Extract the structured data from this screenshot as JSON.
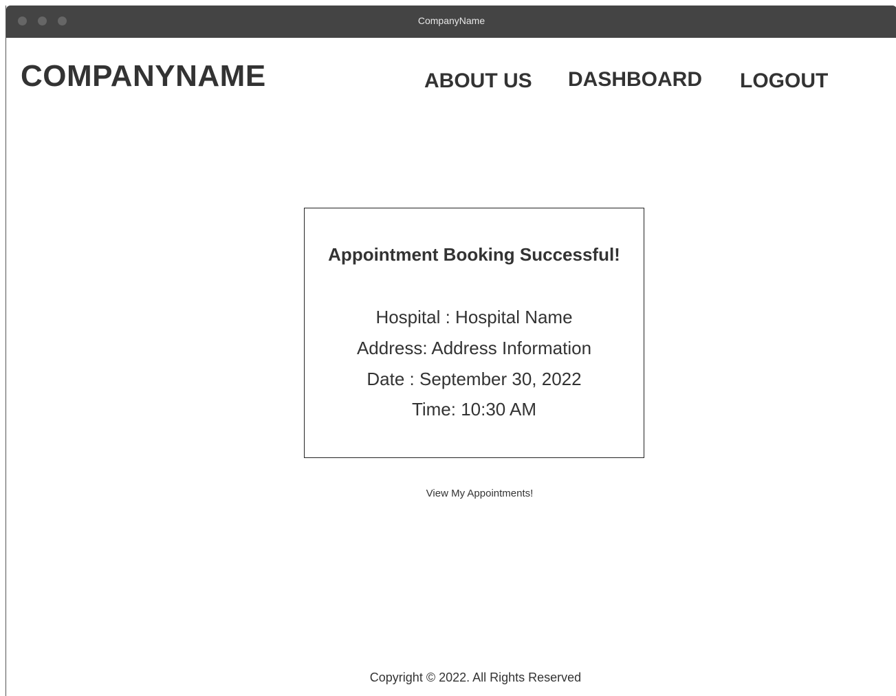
{
  "window": {
    "title": "CompanyName"
  },
  "header": {
    "brand": "COMPANYNAME",
    "nav": {
      "about": "ABOUT US",
      "dashboard": "DASHBOARD",
      "logout": "LOGOUT"
    }
  },
  "confirmation": {
    "title": "Appointment Booking Successful!",
    "hospital": "Hospital : Hospital Name",
    "address": "Address: Address Information",
    "date": "Date : September 30, 2022",
    "time": "Time: 10:30 AM"
  },
  "actions": {
    "view_appointments": "View My Appointments!"
  },
  "footer": {
    "copyright": "Copyright  © 2022. All Rights Reserved"
  },
  "colors": {
    "titlebar": "#444444",
    "text": "#333333",
    "border": "#222222"
  }
}
